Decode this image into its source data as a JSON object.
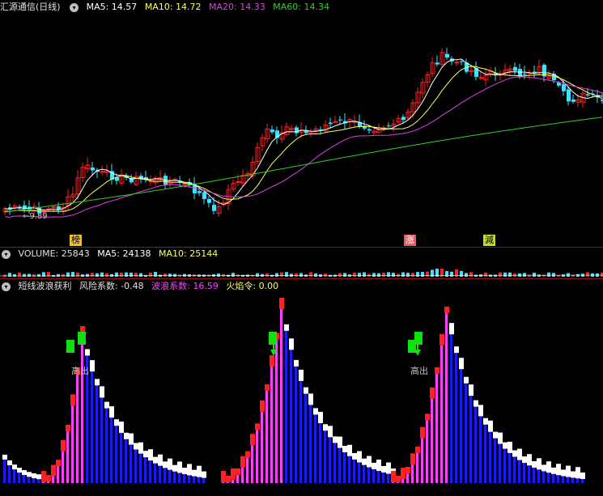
{
  "main": {
    "title": "汇源通信(日线)",
    "ma5": "MA5: 14.57",
    "ma10": "MA10: 14.72",
    "ma20": "MA20: 14.33",
    "ma60": "MA60: 14.34",
    "low_marker": "9.89",
    "events": [
      "榜",
      "涨",
      "減"
    ]
  },
  "volume": {
    "label": "VOLUME: 25843",
    "ma5": "MA5: 24138",
    "ma10": "MA10: 25144"
  },
  "indicator": {
    "name": "短线波浪获利",
    "risk": "风险系数: -0.48",
    "wave": "波浪系数: 16.59",
    "fire": "火焰令: 0.00",
    "sell_label": "高出"
  },
  "colors": {
    "up": "#ff2020",
    "down": "#40e0ff",
    "ma5": "#ffffff",
    "ma10": "#ffff60",
    "ma20": "#e040e0",
    "ma60": "#30d030",
    "wave_up": "#ff40ff",
    "wave_down": "#1a1aff"
  },
  "icons": [
    "chevron-down-icon",
    "arrow-down-icon"
  ]
}
